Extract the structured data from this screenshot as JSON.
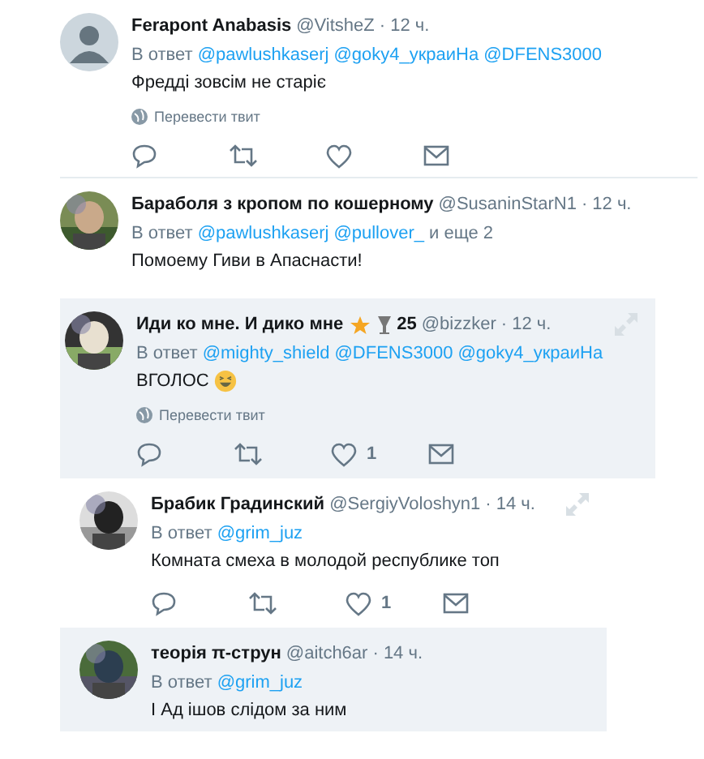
{
  "tweets": [
    {
      "default_avatar": true,
      "name": "Ferapont Anabasis",
      "handle": "@VitsheZ",
      "time": "· 12 ч.",
      "reply_label": "В ответ",
      "mentions": [
        "@pawlushkaserj",
        "@goky4_украиНа",
        "@DFENS3000"
      ],
      "text": "Фредді зовсім не старіє",
      "translate": "Перевести твит",
      "highlighted": false,
      "expand": false,
      "actions": [
        {
          "kind": "reply"
        },
        {
          "kind": "retweet"
        },
        {
          "kind": "like"
        },
        {
          "kind": "message"
        }
      ]
    },
    {
      "default_avatar": false,
      "name": "Бараболя з кропом по кошерному",
      "handle": "@SusaninStarN1",
      "time": "· 12 ч.",
      "reply_label": "В ответ",
      "mentions": [
        "@pawlushkaserj",
        "@pullover_"
      ],
      "reply_suffix": "и еще 2",
      "text": "Помоему Гиви в Апаснасти!",
      "highlighted": false,
      "expand": false
    },
    {
      "default_avatar": false,
      "name": "Иди ко мне. И дико мне",
      "badge": "25",
      "handle": "@bizzker",
      "time": "· 12 ч.",
      "reply_label": "В ответ",
      "mentions": [
        "@mighty_shield",
        "@DFENS3000",
        "@goky4_украиНа"
      ],
      "text": "ВГОЛОС",
      "emoji": true,
      "translate": "Перевести твит",
      "highlighted": true,
      "expand": true,
      "actions": [
        {
          "kind": "reply"
        },
        {
          "kind": "retweet"
        },
        {
          "kind": "like",
          "count": "1"
        },
        {
          "kind": "message"
        }
      ],
      "children": [
        {
          "default_avatar": false,
          "name": "Брабик Градинский",
          "handle": "@SergiyVoloshyn1",
          "time": "· 14 ч.",
          "reply_label": "В ответ",
          "mentions": [
            "@grim_juz"
          ],
          "text": "Комната смеха в молодой республике топ",
          "highlighted": false,
          "expand": true,
          "actions": [
            {
              "kind": "reply"
            },
            {
              "kind": "retweet"
            },
            {
              "kind": "like",
              "count": "1"
            },
            {
              "kind": "message"
            }
          ]
        },
        {
          "default_avatar": false,
          "name": "теорія π-струн",
          "handle": "@aitch6ar",
          "time": "· 14 ч.",
          "reply_label": "В ответ",
          "mentions": [
            "@grim_juz"
          ],
          "text": "І Ад ішов слідом за ним",
          "highlighted": true,
          "expand": false
        }
      ]
    }
  ]
}
